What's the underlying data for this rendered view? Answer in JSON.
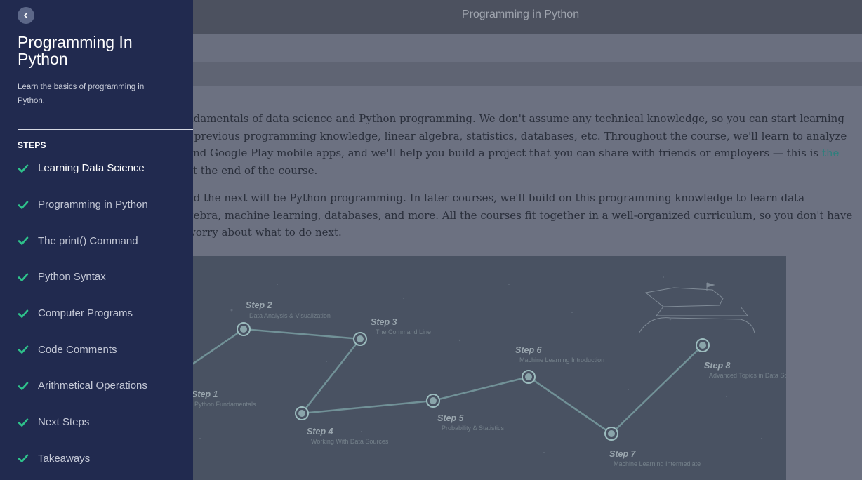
{
  "header": {
    "title": "Programming in Python"
  },
  "sidebar": {
    "course_title": "Programming In Python",
    "course_description": "Learn the basics of programming in Python.",
    "steps_heading": "STEPS",
    "items": [
      {
        "label": "Learning Data Science",
        "completed": true,
        "active": true
      },
      {
        "label": "Programming in Python",
        "completed": true
      },
      {
        "label": "The print() Command",
        "completed": true
      },
      {
        "label": "Python Syntax",
        "completed": true
      },
      {
        "label": "Computer Programs",
        "completed": true
      },
      {
        "label": "Code Comments",
        "completed": true
      },
      {
        "label": "Arithmetical Operations",
        "completed": true
      },
      {
        "label": "Next Steps",
        "completed": true
      },
      {
        "label": "Takeaways",
        "completed": true
      }
    ]
  },
  "content": {
    "paragraph1": {
      "lines": [
        "ndamentals of data science and Python programming. We don't assume any technical knowledge, so you can start learning",
        "t previous programming knowledge, linear algebra, statistics, databases, etc. Throughout the course, we'll learn to analyze",
        "and Google Play mobile apps, and we'll help you build a project that you can share with friends or employers — this is "
      ],
      "link_text": "the",
      "last_line": "at the end of the course."
    },
    "paragraph2": {
      "lines": [
        "nd the next will be Python programming. In later courses, we'll build on this programming knowledge to learn data",
        "gebra, machine learning, databases, and more. All the courses fit together in a well-organized curriculum, so you don't have",
        "worry about what to do next."
      ]
    },
    "roadmap": {
      "steps": [
        {
          "label": "Step 1",
          "sub": "Python Fundamentals"
        },
        {
          "label": "Step 2",
          "sub": "Data Analysis & Visualization"
        },
        {
          "label": "Step 3",
          "sub": "The Command Line"
        },
        {
          "label": "Step 4",
          "sub": "Working With Data Sources"
        },
        {
          "label": "Step 5",
          "sub": "Probability & Statistics"
        },
        {
          "label": "Step 6",
          "sub": "Machine Learning Introduction"
        },
        {
          "label": "Step 7",
          "sub": "Machine Learning Intermediate"
        },
        {
          "label": "Step 8",
          "sub": "Advanced Topics in Data Science"
        }
      ]
    }
  },
  "colors": {
    "sidebar_bg": "#212a4f",
    "check": "#2ec28b",
    "overlay": "#6c7181"
  },
  "icons": {
    "back": "chevron-left-icon",
    "step_status": "check-icon"
  }
}
